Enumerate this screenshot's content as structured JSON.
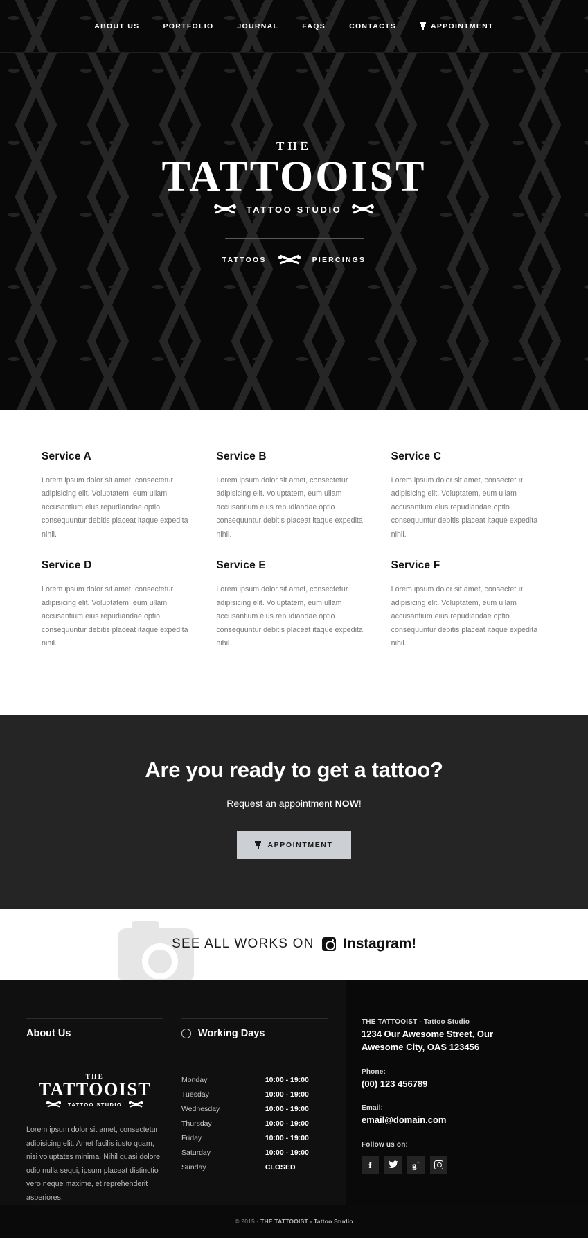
{
  "nav": {
    "items": [
      {
        "label": "ABOUT US",
        "icon": null
      },
      {
        "label": "PORTFOLIO",
        "icon": null
      },
      {
        "label": "JOURNAL",
        "icon": null
      },
      {
        "label": "FAQS",
        "icon": null
      },
      {
        "label": "CONTACTS",
        "icon": null
      },
      {
        "label": "APPOINTMENT",
        "icon": "pin-icon"
      }
    ]
  },
  "hero": {
    "logo_the": "THE",
    "logo_main": "TATTOOIST",
    "logo_sub": "TATTOO STUDIO",
    "tag_left": "TATTOOS",
    "tag_right": "PIERCINGS",
    "machine_icon": "crossed-tattoo-machines-icon"
  },
  "services": [
    {
      "title": "Service A",
      "text": "Lorem ipsum dolor sit amet, consectetur adipisicing elit. Voluptatem, eum ullam accusantium eius repudiandae optio consequuntur debitis placeat itaque expedita nihil."
    },
    {
      "title": "Service B",
      "text": "Lorem ipsum dolor sit amet, consectetur adipisicing elit. Voluptatem, eum ullam accusantium eius repudiandae optio consequuntur debitis placeat itaque expedita nihil."
    },
    {
      "title": "Service C",
      "text": "Lorem ipsum dolor sit amet, consectetur adipisicing elit. Voluptatem, eum ullam accusantium eius repudiandae optio consequuntur debitis placeat itaque expedita nihil."
    },
    {
      "title": "Service D",
      "text": "Lorem ipsum dolor sit amet, consectetur adipisicing elit. Voluptatem, eum ullam accusantium eius repudiandae optio consequuntur debitis placeat itaque expedita nihil."
    },
    {
      "title": "Service E",
      "text": "Lorem ipsum dolor sit amet, consectetur adipisicing elit. Voluptatem, eum ullam accusantium eius repudiandae optio consequuntur debitis placeat itaque expedita nihil."
    },
    {
      "title": "Service F",
      "text": "Lorem ipsum dolor sit amet, consectetur adipisicing elit. Voluptatem, eum ullam accusantium eius repudiandae optio consequuntur debitis placeat itaque expedita nihil."
    }
  ],
  "cta": {
    "title": "Are you ready to get a tattoo?",
    "sub_prefix": "Request an appointment ",
    "sub_strong": "NOW",
    "sub_suffix": "!",
    "button_label": "APPOINTMENT",
    "button_icon": "pin-icon",
    "background": "#252525",
    "button_background": "#ccd0d4"
  },
  "instagram": {
    "prefix": "SEE ALL WORKS ON",
    "icon": "instagram-icon",
    "name": "Instagram",
    "suffix": "!"
  },
  "footer": {
    "about": {
      "heading": "About Us",
      "logo_the": "THE",
      "logo_main": "TATTOOIST",
      "logo_sub": "TATTOO STUDIO",
      "text": "Lorem ipsum dolor sit amet, consectetur adipisicing elit. Amet facilis iusto quam, nisi voluptates minima. Nihil quasi dolore odio nulla sequi, ipsum placeat distinctio vero neque maxime, et reprehenderit asperiores."
    },
    "working_days": {
      "heading": "Working Days",
      "icon": "clock-icon",
      "rows": [
        {
          "day": "Monday",
          "time": "10:00 - 19:00"
        },
        {
          "day": "Tuesday",
          "time": "10:00 - 19:00"
        },
        {
          "day": "Wednesday",
          "time": "10:00 - 19:00"
        },
        {
          "day": "Thursday",
          "time": "10:00 - 19:00"
        },
        {
          "day": "Friday",
          "time": "10:00 - 19:00"
        },
        {
          "day": "Saturday",
          "time": "10:00 - 19:00"
        },
        {
          "day": "Sunday",
          "time": "CLOSED"
        }
      ]
    },
    "contact": {
      "company": "THE TATTOOIST - Tattoo Studio",
      "address_line1": "1234 Our Awesome Street, Our",
      "address_line2": "Awesome City, OAS 123456",
      "phone_label": "Phone:",
      "phone_value": "(00) 123 456789",
      "email_label": "Email:",
      "email_value": "email@domain.com",
      "follow_label": "Follow us on:",
      "socials": [
        {
          "name": "facebook-icon",
          "glyph": "f"
        },
        {
          "name": "twitter-icon",
          "glyph": "ᵗ"
        },
        {
          "name": "google-plus-icon",
          "glyph": "g"
        },
        {
          "name": "instagram-icon",
          "glyph": ""
        }
      ]
    },
    "copyright_prefix": "© 2015 - ",
    "copyright_strong": "THE TATTOOIST - Tattoo Studio"
  }
}
